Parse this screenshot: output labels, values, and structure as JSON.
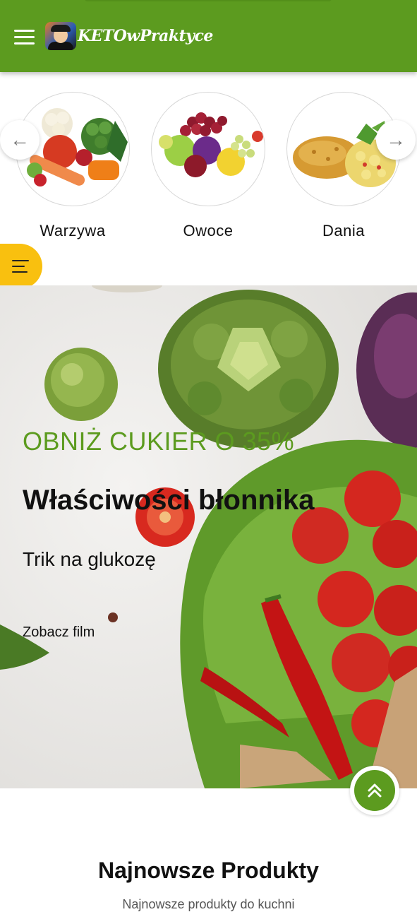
{
  "header": {
    "logo_text": "KETOwPraktyce",
    "menu_icon": "hamburger-icon",
    "brand_color": "#5c9b1f"
  },
  "categories": {
    "items": [
      {
        "label": "Warzywa",
        "image": "vegetables"
      },
      {
        "label": "Owoce",
        "image": "fruits"
      },
      {
        "label": "Dania",
        "image": "dishes"
      }
    ],
    "prev_icon": "arrow-left-icon",
    "next_icon": "arrow-right-icon"
  },
  "side_tab": {
    "icon": "menu-lines-icon",
    "color": "#f9c00f"
  },
  "hero": {
    "kicker": "OBNIŻ CUKIER O 35%",
    "title": "Właściwości błonnika",
    "subtitle": "Trik na glukozę",
    "link": "Zobacz film"
  },
  "scroll_top": {
    "icon": "double-chevron-up-icon"
  },
  "section": {
    "title": "Najnowsze Produkty",
    "subtitle": "Najnowsze produkty do kuchni"
  }
}
